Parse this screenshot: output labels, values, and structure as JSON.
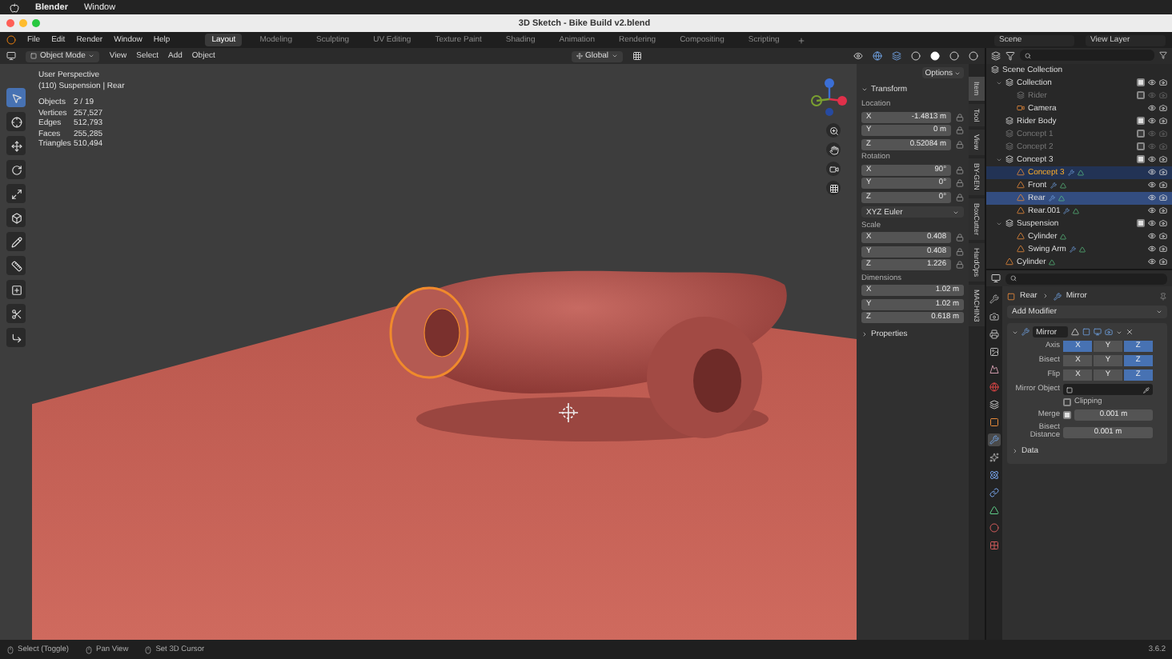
{
  "os_menu": {
    "app": "Blender",
    "items": [
      "Window"
    ]
  },
  "window": {
    "title": "3D Sketch - Bike Build v2.blend"
  },
  "menu": [
    "File",
    "Edit",
    "Render",
    "Window",
    "Help"
  ],
  "workspaces": [
    {
      "label": "Layout",
      "selected": true
    },
    {
      "label": "Modeling",
      "selected": false
    },
    {
      "label": "Sculpting",
      "selected": false
    },
    {
      "label": "UV Editing",
      "selected": false
    },
    {
      "label": "Texture Paint",
      "selected": false
    },
    {
      "label": "Shading",
      "selected": false
    },
    {
      "label": "Animation",
      "selected": false
    },
    {
      "label": "Rendering",
      "selected": false
    },
    {
      "label": "Compositing",
      "selected": false
    },
    {
      "label": "Scripting",
      "selected": false
    }
  ],
  "scene": "Scene",
  "view_layer": "View Layer",
  "viewport": {
    "mode": "Object Mode",
    "menus": [
      "View",
      "Select",
      "Add",
      "Object"
    ],
    "orientation": "Global",
    "options": "Options",
    "overlay": {
      "title": "User Perspective",
      "context": "(110) Suspension | Rear",
      "stats": [
        {
          "label": "Objects",
          "value": "2 / 19"
        },
        {
          "label": "Vertices",
          "value": "257,527"
        },
        {
          "label": "Edges",
          "value": "512,793"
        },
        {
          "label": "Faces",
          "value": "255,285"
        },
        {
          "label": "Triangles",
          "value": "510,494"
        }
      ]
    },
    "tools": [
      {
        "kind": "select",
        "selected": true
      },
      {
        "kind": "cursor",
        "selected": false
      },
      {
        "kind": "move",
        "selected": false
      },
      {
        "kind": "rotate",
        "selected": false
      },
      {
        "kind": "scale",
        "selected": false
      },
      {
        "kind": "transform",
        "selected": false
      },
      {
        "kind": "annotate",
        "selected": false
      },
      {
        "kind": "measure",
        "selected": false
      },
      {
        "kind": "add",
        "selected": false
      },
      {
        "kind": "cut",
        "selected": false
      },
      {
        "kind": "bevel",
        "selected": false
      }
    ]
  },
  "sidebar": {
    "tabs": [
      {
        "label": "Item",
        "selected": true
      },
      {
        "label": "Tool",
        "selected": false
      },
      {
        "label": "View",
        "selected": false
      },
      {
        "label": "BY-GEN",
        "selected": false
      },
      {
        "label": "BoxCutter",
        "selected": false
      },
      {
        "label": "HardOps",
        "selected": false
      },
      {
        "label": "MACHIN3",
        "selected": false
      }
    ],
    "transform": {
      "title": "Transform",
      "groups": [
        {
          "label": "Location",
          "lockable": true,
          "rows": [
            {
              "axis": "X",
              "value": "-1.4813 m"
            },
            {
              "axis": "Y",
              "value": "0 m"
            },
            {
              "axis": "Z",
              "value": "0.52084 m"
            }
          ]
        },
        {
          "label": "Rotation",
          "lockable": true,
          "mode": "XYZ Euler",
          "rows": [
            {
              "axis": "X",
              "value": "90°"
            },
            {
              "axis": "Y",
              "value": "0°"
            },
            {
              "axis": "Z",
              "value": "0°"
            }
          ]
        },
        {
          "label": "Scale",
          "lockable": true,
          "rows": [
            {
              "axis": "X",
              "value": "0.408"
            },
            {
              "axis": "Y",
              "value": "0.408"
            },
            {
              "axis": "Z",
              "value": "1.226"
            }
          ]
        },
        {
          "label": "Dimensions",
          "lockable": false,
          "rows": [
            {
              "axis": "X",
              "value": "1.02 m"
            },
            {
              "axis": "Y",
              "value": "1.02 m"
            },
            {
              "axis": "Z",
              "value": "0.618 m"
            }
          ]
        }
      ]
    },
    "properties": {
      "title": "Properties",
      "expanded": false
    }
  },
  "outliner": {
    "root": "Scene Collection",
    "items": [
      {
        "label": "Collection",
        "kind": "collection",
        "checked": true,
        "selected": false,
        "active": false,
        "children": [
          {
            "label": "Rider",
            "kind": "collection",
            "checked": false,
            "selected": false,
            "active": false
          },
          {
            "label": "Camera",
            "kind": "camera",
            "selected": false,
            "active": false
          }
        ]
      },
      {
        "label": "Rider Body",
        "kind": "collection",
        "checked": true,
        "selected": false,
        "active": false
      },
      {
        "label": "Concept 1",
        "kind": "collection",
        "checked": false,
        "selected": false,
        "active": false
      },
      {
        "label": "Concept 2",
        "kind": "collection",
        "checked": false,
        "selected": false,
        "active": false
      },
      {
        "label": "Concept 3",
        "kind": "collection",
        "checked": true,
        "selected": false,
        "active": false,
        "children": [
          {
            "label": "Concept 3",
            "kind": "mesh",
            "modified": true,
            "selected": true,
            "active": false
          },
          {
            "label": "Front",
            "kind": "mesh",
            "modified": true,
            "selected": false,
            "active": false
          },
          {
            "label": "Rear",
            "kind": "mesh",
            "modified": true,
            "selected": true,
            "active": true
          },
          {
            "label": "Rear.001",
            "kind": "mesh",
            "modified": true,
            "selected": false,
            "active": false
          }
        ]
      },
      {
        "label": "Suspension",
        "kind": "collection",
        "checked": true,
        "selected": false,
        "active": false,
        "children": [
          {
            "label": "Cylinder",
            "kind": "mesh",
            "modified": false,
            "selected": false,
            "active": false
          },
          {
            "label": "Swing Arm",
            "kind": "mesh",
            "modified": true,
            "selected": false,
            "active": false
          }
        ]
      },
      {
        "label": "Cylinder",
        "kind": "mesh",
        "modified": false,
        "selected": false,
        "active": false
      }
    ]
  },
  "property_tabs": [
    {
      "kind": "tool",
      "selected": false
    },
    {
      "kind": "render",
      "selected": false
    },
    {
      "kind": "output",
      "selected": false
    },
    {
      "kind": "view",
      "selected": false
    },
    {
      "kind": "scene",
      "selected": false
    },
    {
      "kind": "world",
      "selected": false
    },
    {
      "kind": "collection",
      "selected": false
    },
    {
      "kind": "object",
      "selected": false
    },
    {
      "kind": "modifier",
      "selected": true
    },
    {
      "kind": "particles",
      "selected": false
    },
    {
      "kind": "physics",
      "selected": false
    },
    {
      "kind": "constraints",
      "selected": false
    },
    {
      "kind": "data",
      "selected": false
    },
    {
      "kind": "material",
      "selected": false
    },
    {
      "kind": "texture",
      "selected": false
    }
  ],
  "modifiers": {
    "object": "Rear",
    "modifier": "Mirror",
    "add_modifier": "Add Modifier",
    "panel": {
      "name": "Mirror",
      "expanded": true,
      "toggles": [
        {
          "label": "Axis",
          "buttons": [
            {
              "label": "X",
              "selected": true
            },
            {
              "label": "Y",
              "selected": false
            },
            {
              "label": "Z",
              "selected": true
            }
          ]
        },
        {
          "label": "Bisect",
          "buttons": [
            {
              "label": "X",
              "selected": false
            },
            {
              "label": "Y",
              "selected": false
            },
            {
              "label": "Z",
              "selected": true
            }
          ]
        },
        {
          "label": "Flip",
          "buttons": [
            {
              "label": "X",
              "selected": false
            },
            {
              "label": "Y",
              "selected": false
            },
            {
              "label": "Z",
              "selected": true
            }
          ]
        }
      ],
      "mirror_object": "Mirror Object",
      "clipping": {
        "label": "Clipping",
        "checked": false
      },
      "merge": {
        "label": "Merge",
        "checked": true,
        "value": "0.001 m"
      },
      "bisect_distance": {
        "label": "Bisect Distance",
        "value": "0.001 m"
      },
      "data": {
        "label": "Data",
        "expanded": false
      }
    }
  },
  "status_bar": {
    "items": [
      "Select (Toggle)",
      "Pan View",
      "Set 3D Cursor"
    ],
    "version": "3.6.2"
  }
}
